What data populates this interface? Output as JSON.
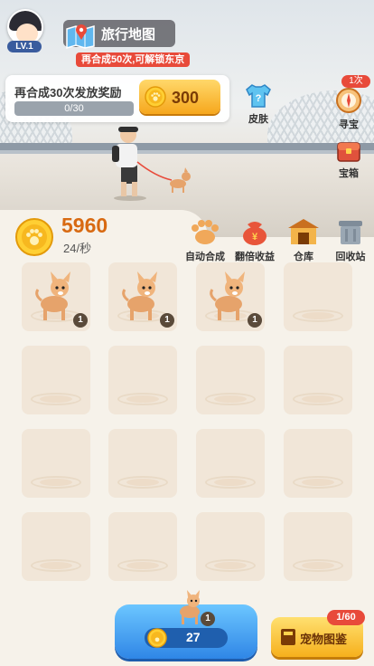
{
  "player": {
    "level": "LV.1"
  },
  "map": {
    "title": "旅行地图",
    "hint": "再合成50次,可解锁东京"
  },
  "task": {
    "label": "再合成30次发放奖励",
    "progress": "0/30",
    "reward": "300"
  },
  "side": {
    "skin_label": "皮肤",
    "treasure_hunt_label": "寻宝",
    "treasure_hunt_badge": "1次",
    "chest_label": "宝箱"
  },
  "coins": {
    "value": "5960",
    "rate": "24/秒"
  },
  "tools": [
    {
      "label": "自动合成"
    },
    {
      "label": "翻倍收益"
    },
    {
      "label": "仓库"
    },
    {
      "label": "回收站"
    }
  ],
  "grid": [
    {
      "pet": true,
      "level": "1"
    },
    {
      "pet": true,
      "level": "1"
    },
    {
      "pet": true,
      "level": "1"
    },
    {
      "pet": false
    },
    {
      "pet": false
    },
    {
      "pet": false
    },
    {
      "pet": false
    },
    {
      "pet": false
    },
    {
      "pet": false
    },
    {
      "pet": false
    },
    {
      "pet": false
    },
    {
      "pet": false
    },
    {
      "pet": false
    },
    {
      "pet": false
    },
    {
      "pet": false
    },
    {
      "pet": false
    }
  ],
  "buy": {
    "pet_level": "1",
    "cost": "27"
  },
  "book": {
    "label": "宠物图鉴",
    "badge": "1/60"
  },
  "colors": {
    "accent": "#d86a12",
    "buy": "#2f86e6",
    "gold": "#f6b01c",
    "red": "#e84a3a"
  }
}
